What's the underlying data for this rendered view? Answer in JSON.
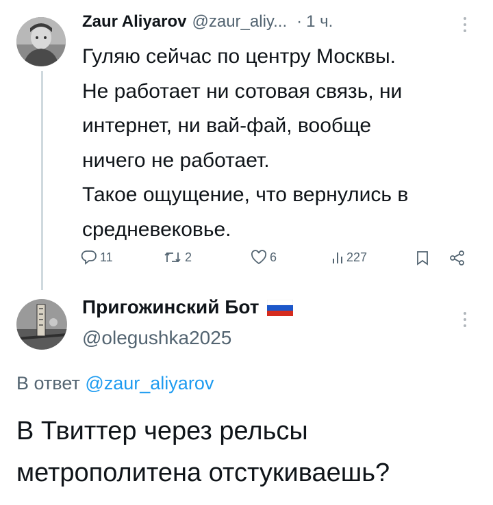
{
  "tweet": {
    "author_name": "Zaur Aliyarov",
    "handle": "@zaur_aliy...",
    "separator": "·",
    "time": "1 ч.",
    "text_lines": [
      "Гуляю сейчас по центру Москвы.",
      "Не работает ни сотовая связь, ни",
      "интернет, ни вай-фай, вообще",
      "ничего не работает.",
      "Такое ощущение, что вернулись в",
      "средневековье."
    ],
    "actions": {
      "replies": "11",
      "retweets": "2",
      "likes": "6",
      "views": "227"
    },
    "icons": [
      "more-icon",
      "reply-icon",
      "retweet-icon",
      "like-icon",
      "views-icon",
      "bookmark-icon",
      "share-icon"
    ]
  },
  "reply": {
    "author_name": "Пригожинский Бот",
    "flag": "Russian flag",
    "handle": "@olegushka2025",
    "reply_to_prefix": "В ответ",
    "reply_to_handle": "@zaur_aliyarov",
    "text_lines": [
      "В Твиттер через рельсы",
      "метрополитена отстукиваешь?"
    ]
  },
  "colors": {
    "text": "#0f1419",
    "muted": "#536471",
    "link": "#1d9bf0",
    "thread_line": "#cfd9de"
  }
}
